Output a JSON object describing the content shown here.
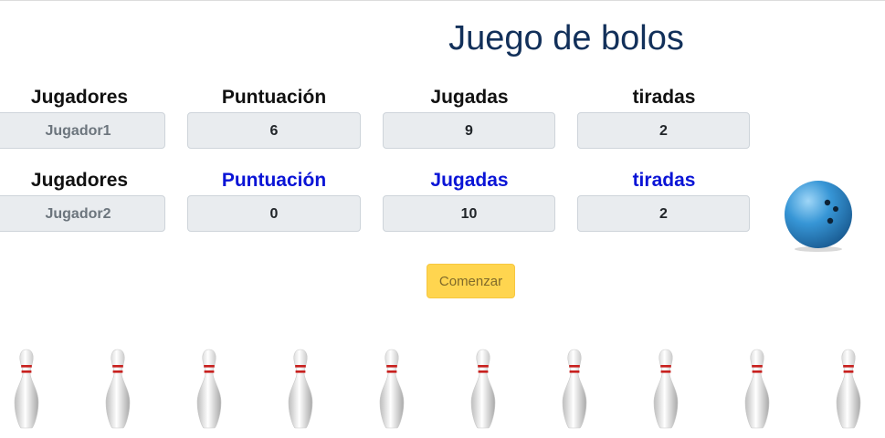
{
  "title": "Juego de bolos",
  "players": [
    {
      "headers": {
        "players": "Jugadores",
        "score": "Puntuación",
        "plays": "Jugadas",
        "throws": "tiradas"
      },
      "name": "Jugador1",
      "score": "6",
      "plays": "9",
      "throws": "2",
      "active": false
    },
    {
      "headers": {
        "players": "Jugadores",
        "score": "Puntuación",
        "plays": "Jugadas",
        "throws": "tiradas"
      },
      "name": "Jugador2",
      "score": "0",
      "plays": "10",
      "throws": "2",
      "active": true
    }
  ],
  "start_button": "Comenzar",
  "pins_count": 10,
  "colors": {
    "title": "#12305a",
    "active_header": "#0a14d6",
    "button_bg": "#ffd54f",
    "field_bg": "#e9ecef",
    "ball": "#2f8fd0",
    "pin_stripe": "#c8201e"
  },
  "icons": {
    "ball": "bowling-ball-icon",
    "pin": "bowling-pin-icon"
  }
}
